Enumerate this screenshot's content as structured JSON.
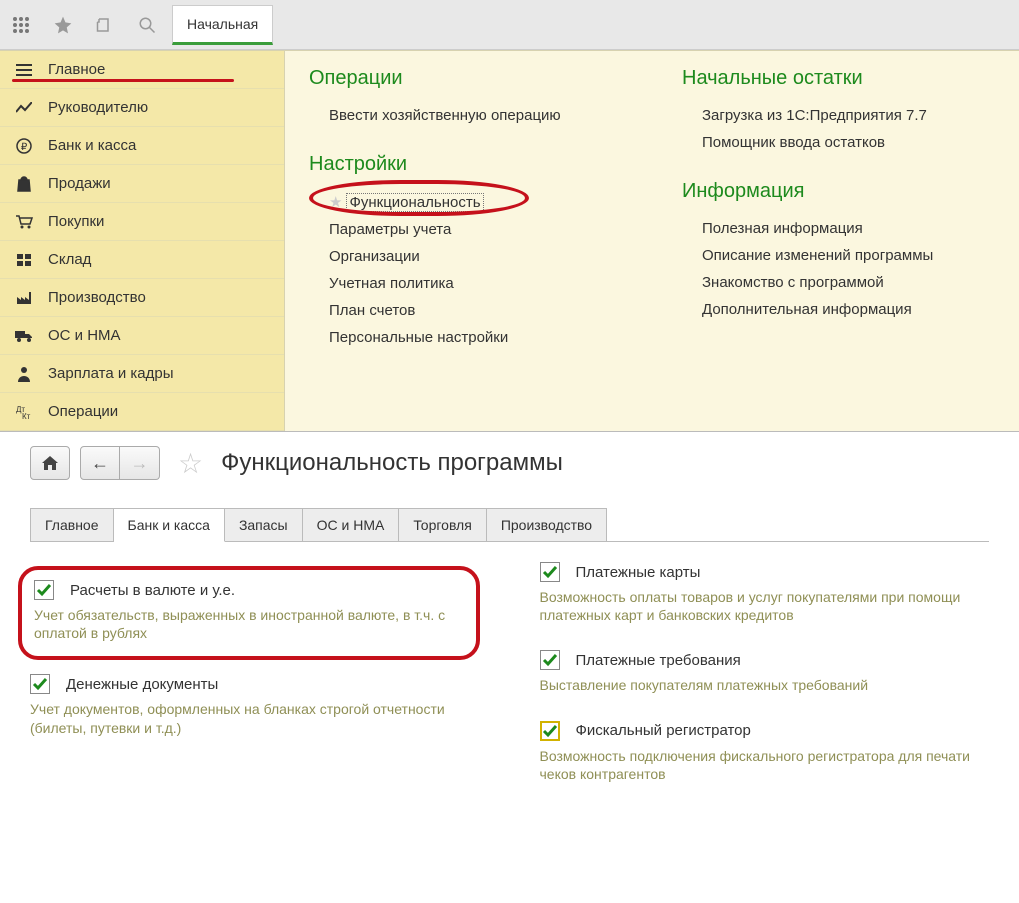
{
  "toolbar": {
    "tab_label": "Начальная"
  },
  "sidebar": {
    "items": [
      {
        "icon": "menu",
        "label": "Главное"
      },
      {
        "icon": "chart",
        "label": "Руководителю"
      },
      {
        "icon": "ruble",
        "label": "Банк и касса"
      },
      {
        "icon": "bag",
        "label": "Продажи"
      },
      {
        "icon": "cart",
        "label": "Покупки"
      },
      {
        "icon": "boxes",
        "label": "Склад"
      },
      {
        "icon": "factory",
        "label": "Производство"
      },
      {
        "icon": "truck",
        "label": "ОС и НМА"
      },
      {
        "icon": "person",
        "label": "Зарплата и кадры"
      },
      {
        "icon": "ops",
        "label": "Операции"
      }
    ]
  },
  "menu": {
    "left": [
      {
        "heading": "Операции",
        "items": [
          "Ввести хозяйственную операцию"
        ]
      },
      {
        "heading": "Настройки",
        "items_hl": "Функциональность",
        "items": [
          "Параметры учета",
          "Организации",
          "Учетная политика",
          "План счетов",
          "Персональные настройки"
        ]
      }
    ],
    "right": [
      {
        "heading": "Начальные остатки",
        "items": [
          "Загрузка из 1С:Предприятия 7.7",
          "Помощник ввода остатков"
        ]
      },
      {
        "heading": "Информация",
        "items": [
          "Полезная информация",
          "Описание изменений программы",
          "Знакомство с программой",
          "Дополнительная информация"
        ]
      }
    ]
  },
  "lower": {
    "title": "Функциональность программы",
    "tabs": [
      "Главное",
      "Банк и касса",
      "Запасы",
      "ОС и НМА",
      "Торговля",
      "Производство"
    ],
    "active_tab": 1,
    "options_left": [
      {
        "label": "Расчеты в валюте и у.е.",
        "desc": "Учет обязательств, выраженных в иностранной валюте, в т.ч. с оплатой в рублях",
        "checked": true,
        "highlighted": true
      },
      {
        "label": "Денежные документы",
        "desc": "Учет документов, оформленных на бланках строгой отчетности (билеты, путевки и т.д.)",
        "checked": true
      }
    ],
    "options_right": [
      {
        "label": "Платежные карты",
        "desc": "Возможность оплаты товаров и услуг покупателями при помощи платежных карт и банковских кредитов",
        "checked": true
      },
      {
        "label": "Платежные требования",
        "desc": "Выставление покупателям платежных требований",
        "checked": true
      },
      {
        "label": "Фискальный регистратор",
        "desc": "Возможность подключения фискального регистратора для печати чеков контрагентов",
        "checked": true,
        "yellow": true
      }
    ]
  }
}
